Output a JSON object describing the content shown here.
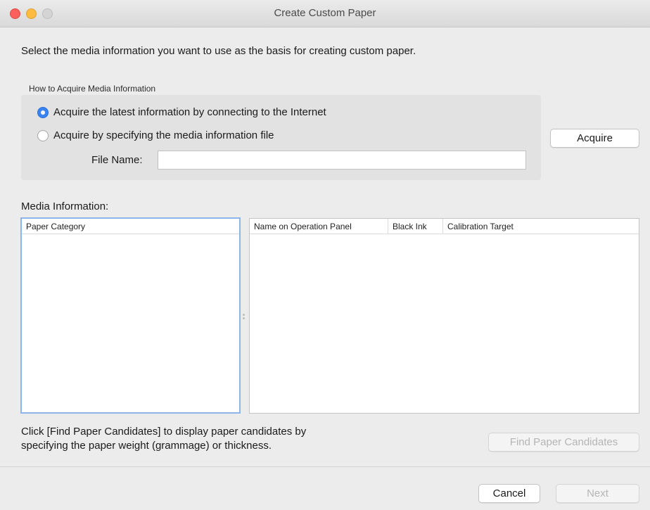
{
  "window": {
    "title": "Create Custom Paper"
  },
  "instruction": "Select the media information you want to use as the basis for creating custom paper.",
  "acquire_group": {
    "caption": "How to Acquire Media Information",
    "options": [
      {
        "label": "Acquire the latest information by connecting to the Internet",
        "selected": true
      },
      {
        "label": "Acquire by specifying the media information file",
        "selected": false
      }
    ],
    "file_name_label": "File Name:",
    "file_name_value": ""
  },
  "acquire_button": "Acquire",
  "media_information": {
    "label": "Media Information:",
    "left_columns": [
      "Paper Category"
    ],
    "right_columns": [
      "Name on Operation Panel",
      "Black Ink",
      "Calibration Target"
    ]
  },
  "hint": {
    "line1": "Click [Find Paper Candidates] to display paper candidates by",
    "line2": "specifying the paper weight (grammage) or thickness."
  },
  "buttons": {
    "find": "Find Paper Candidates",
    "cancel": "Cancel",
    "next": "Next"
  },
  "colors": {
    "accent": "#3b82f2",
    "focus_ring": "#8fb4ea"
  },
  "icons": {
    "close": "close-icon",
    "minimize": "minimize-icon",
    "zoom": "zoom-icon"
  }
}
